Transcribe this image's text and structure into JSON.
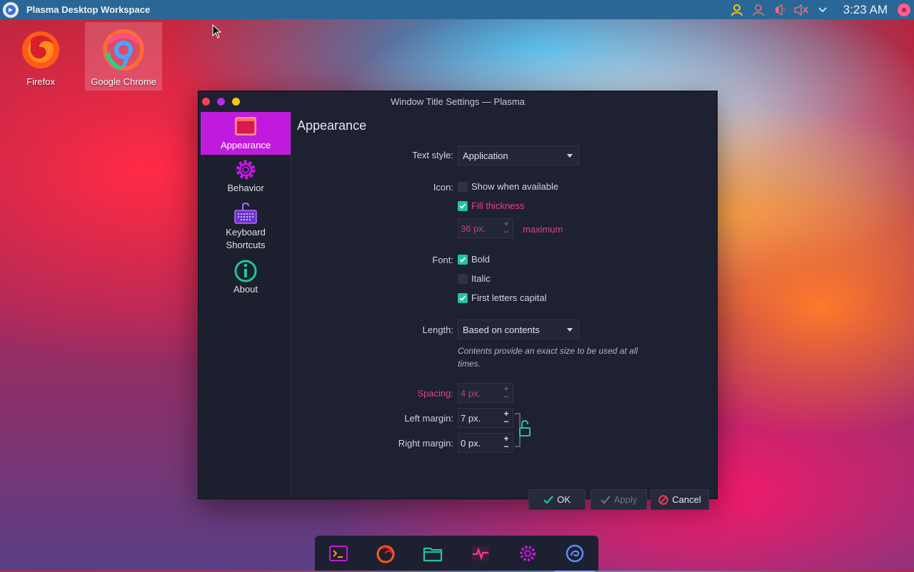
{
  "top_panel": {
    "title": "Plasma Desktop Workspace",
    "clock": "3:23 AM"
  },
  "desktop": {
    "icons": [
      {
        "label": "Firefox"
      },
      {
        "label": "Google Chrome"
      }
    ]
  },
  "window": {
    "title": "Window Title Settings — Plasma",
    "sidebar": [
      {
        "label": "Appearance"
      },
      {
        "label": "Behavior"
      },
      {
        "label": "Keyboard Shortcuts"
      },
      {
        "label": "About"
      }
    ],
    "heading": "Appearance",
    "text_style": {
      "label": "Text style:",
      "value": "Application"
    },
    "icon": {
      "label": "Icon:",
      "show_when_available": "Show when available",
      "show_checked": false,
      "fill_thickness": "Fill thickness",
      "fill_checked": true,
      "size_value": "36 px.",
      "maximum": "maximum"
    },
    "font": {
      "label": "Font:",
      "bold": "Bold",
      "bold_checked": true,
      "italic": "Italic",
      "italic_checked": false,
      "first_letters": "First letters capital",
      "first_checked": true
    },
    "length": {
      "label": "Length:",
      "value": "Based on contents",
      "note": "Contents provide an exact size to be used at all times."
    },
    "spacing": {
      "label": "Spacing:",
      "value": "4 px."
    },
    "left_margin": {
      "label": "Left margin:",
      "value": "7 px."
    },
    "right_margin": {
      "label": "Right margin:",
      "value": "0 px."
    },
    "buttons": {
      "ok": "OK",
      "apply": "Apply",
      "cancel": "Cancel"
    }
  },
  "colors": {
    "accent": "#c01bdc",
    "check": "#1fc69a",
    "pink_text": "#e0457f",
    "panel": "#2a6796"
  }
}
